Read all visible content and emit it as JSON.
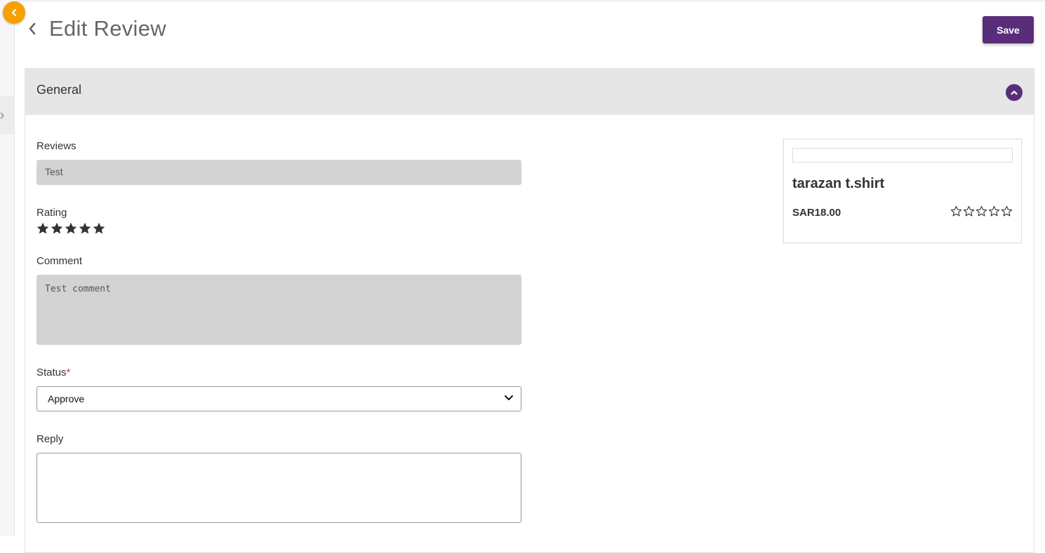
{
  "header": {
    "title": "Edit Review",
    "save_label": "Save"
  },
  "colors": {
    "accent": "#5a2d7a",
    "collapse": "#f5a000",
    "input_readonly": "#d3d3d3"
  },
  "section": {
    "title": "General",
    "expanded": true
  },
  "form": {
    "reviews_label": "Reviews",
    "reviews_value": "Test",
    "rating_label": "Rating",
    "rating_value": 5,
    "rating_max": 5,
    "comment_label": "Comment",
    "comment_value": "Test comment",
    "status_label": "Status",
    "status_required": "*",
    "status_value": "Approve",
    "reply_label": "Reply",
    "reply_value": ""
  },
  "product": {
    "name": "tarazan t.shirt",
    "price": "SAR18.00",
    "rating_value": 0,
    "rating_max": 5
  },
  "icons": {
    "collapse": "chevron-left-icon",
    "back": "chevron-left-icon",
    "section_toggle": "chevron-up-icon",
    "select": "chevron-down-icon",
    "rating": "star-icon"
  }
}
